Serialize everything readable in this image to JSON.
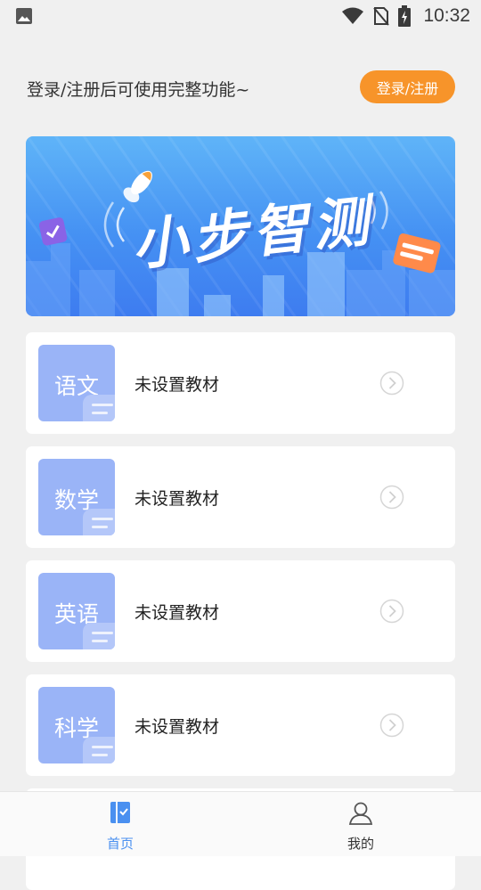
{
  "status_bar": {
    "time": "10:32"
  },
  "header": {
    "login_prompt": "登录/注册后可使用完整功能~",
    "login_button": "登录/注册"
  },
  "banner": {
    "title": "小步智测"
  },
  "subjects": [
    {
      "name": "语文",
      "textbook": "未设置教材"
    },
    {
      "name": "数学",
      "textbook": "未设置教材"
    },
    {
      "name": "英语",
      "textbook": "未设置教材"
    },
    {
      "name": "科学",
      "textbook": "未设置教材"
    }
  ],
  "tabbar": {
    "tabs": [
      {
        "label": "首页",
        "icon": "home-book-icon",
        "active": true
      },
      {
        "label": "我的",
        "icon": "user-profile-icon",
        "active": false
      }
    ]
  },
  "colors": {
    "accent": "#4a90f0",
    "login_button": "#f7942a",
    "subject_tile": "#9ab4f7",
    "background": "#f0f0f0"
  }
}
